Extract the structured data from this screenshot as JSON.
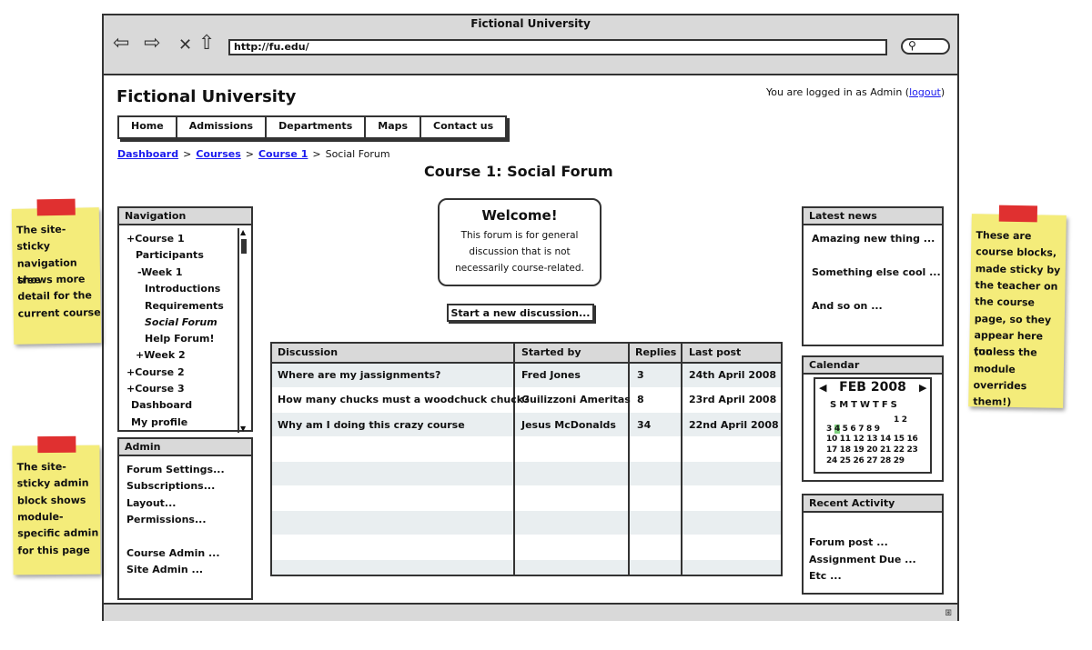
{
  "browser": {
    "title": "Fictional University",
    "url": "http://fu.edu/",
    "nav_icons": [
      "back-arrow-icon",
      "forward-arrow-icon",
      "stop-icon",
      "home-icon"
    ]
  },
  "site": {
    "title": "Fictional University",
    "login_prefix": "You are logged in as Admin (",
    "logout": "logout",
    "login_suffix": ")"
  },
  "menu": [
    "Home",
    "Admissions",
    "Departments",
    "Maps",
    "Contact us"
  ],
  "breadcrumb": [
    "Dashboard",
    "Courses",
    "Course 1",
    "Social Forum"
  ],
  "page_title": "Course 1: Social Forum",
  "navigation": {
    "title": "Navigation",
    "items": [
      "+Course 1",
      "Participants",
      "-Week 1",
      "Introductions",
      "Requirements",
      "Social Forum",
      "Help Forum!",
      "+Week 2",
      "+Course 2",
      "+Course 3",
      "Dashboard",
      "My profile"
    ]
  },
  "admin": {
    "title": "Admin",
    "items": [
      "Forum Settings...",
      "Subscriptions...",
      "Layout...",
      "Permissions...",
      "Course Admin ...",
      "Site Admin ..."
    ]
  },
  "welcome": {
    "title": "Welcome!",
    "lines": [
      "This forum is for general",
      "discussion that is not",
      "necessarily course-related."
    ]
  },
  "new_discussion_button": "Start a new discussion...",
  "table": {
    "headers": [
      "Discussion",
      "Started by",
      "Replies",
      "Last post"
    ],
    "rows": [
      [
        "Where are my jassignments?",
        "Fred Jones",
        "3",
        "24th April 2008"
      ],
      [
        "How many chucks must a woodchuck chuck?",
        "Guilizzoni Ameritas",
        "8",
        "23rd April 2008"
      ],
      [
        "Why am I doing this crazy course",
        "Jesus McDonalds",
        "34",
        "22nd April 2008"
      ]
    ]
  },
  "latest_news": {
    "title": "Latest news",
    "items": [
      "Amazing new thing ...",
      "Something else cool ...",
      "And so on ..."
    ]
  },
  "calendar": {
    "title": "Calendar",
    "month": "FEB 2008",
    "day_headers": "SMTWTFS",
    "weeks": [
      "1 2",
      "3 4 5 6 7 8 9",
      "10 11 12 13 14 15 16",
      "17 18 19 20 21 22 23",
      "24 25 26 27 28 29"
    ],
    "highlight_color": "#7fd07f"
  },
  "recent_activity": {
    "title": "Recent Activity",
    "items": [
      "Forum post ...",
      "Assignment Due ...",
      "Etc ..."
    ]
  },
  "stickies": {
    "nav": [
      "The site-",
      "sticky",
      "navigation tree",
      "shows more",
      "detail for the",
      "current course"
    ],
    "admin": [
      "The site-",
      "sticky admin",
      "block shows",
      "module-",
      "specific admin",
      "for this page"
    ],
    "course": [
      "These are",
      "course blocks,",
      "made sticky by",
      "the teacher on",
      "the course",
      "page, so they",
      "appear here too",
      "(unless the",
      "module",
      "overrides them!)"
    ]
  },
  "colors": {
    "sticky": "#f4ec7a",
    "tape": "#e03030",
    "link": "#1a1aee",
    "header_gray": "#d9d9d9"
  }
}
